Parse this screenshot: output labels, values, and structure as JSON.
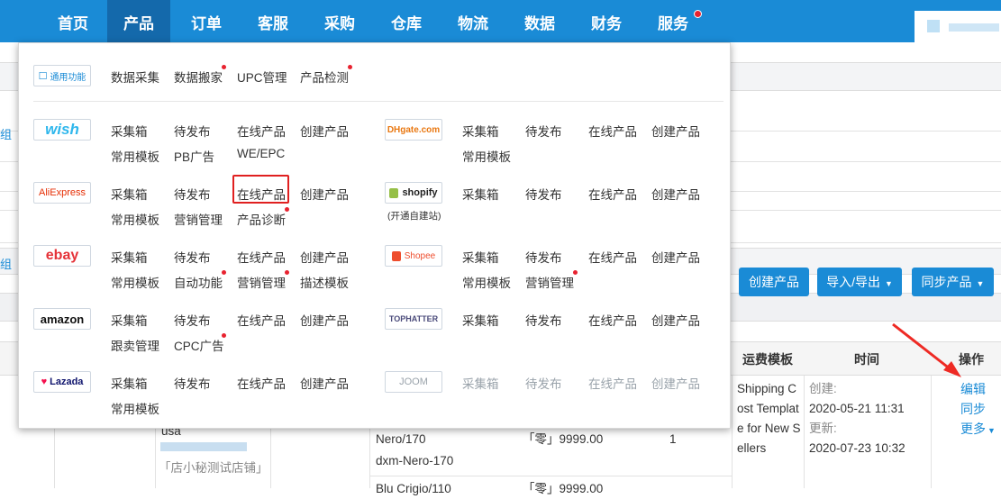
{
  "nav": {
    "items": [
      "首页",
      "产品",
      "订单",
      "客服",
      "采购",
      "仓库",
      "物流",
      "数据",
      "财务",
      "服务"
    ],
    "active": "产品"
  },
  "menu": {
    "general": {
      "logo_text": "通用功能",
      "items": [
        "数据采集",
        "数据搬家",
        "UPC管理",
        "产品检测"
      ]
    },
    "platforms": {
      "wish": {
        "logo": "wish",
        "row1": [
          "采集箱",
          "待发布",
          "在线产品",
          "创建产品"
        ],
        "row2": [
          "常用模板",
          "PB广告",
          "WE/EPC"
        ]
      },
      "dhgate": {
        "logo": "DHgate.com",
        "row1": [
          "采集箱",
          "待发布",
          "在线产品",
          "创建产品"
        ],
        "row2": [
          "常用模板"
        ]
      },
      "aliexpress": {
        "logo": "AliExpress",
        "row1": [
          "采集箱",
          "待发布",
          "在线产品",
          "创建产品"
        ],
        "row2": [
          "常用模板",
          "营销管理",
          "产品诊断"
        ]
      },
      "shopify": {
        "logo": "shopify",
        "sub": "(开通自建站)",
        "row1": [
          "采集箱",
          "待发布",
          "在线产品",
          "创建产品"
        ]
      },
      "ebay": {
        "logo": "ebay",
        "row1": [
          "采集箱",
          "待发布",
          "在线产品",
          "创建产品"
        ],
        "row2": [
          "常用模板",
          "自动功能",
          "营销管理",
          "描述模板"
        ]
      },
      "shopee": {
        "logo": "Shopee",
        "row1": [
          "采集箱",
          "待发布",
          "在线产品",
          "创建产品"
        ],
        "row2": [
          "常用模板",
          "营销管理"
        ]
      },
      "amazon": {
        "logo": "amazon",
        "row1": [
          "采集箱",
          "待发布",
          "在线产品",
          "创建产品"
        ],
        "row2": [
          "跟卖管理",
          "CPC广告"
        ]
      },
      "tophatter": {
        "logo": "TOPHATTER",
        "row1": [
          "采集箱",
          "待发布",
          "在线产品",
          "创建产品"
        ]
      },
      "lazada": {
        "logo": "Lazada",
        "row1": [
          "采集箱",
          "待发布",
          "在线产品",
          "创建产品"
        ],
        "row2": [
          "常用模板"
        ]
      },
      "joom": {
        "logo": "JOOM",
        "row1": [
          "采集箱",
          "待发布",
          "在线产品",
          "创建产品"
        ]
      }
    }
  },
  "page": {
    "edge_labels": [
      "组",
      "组"
    ],
    "buttons": {
      "create": "创建产品",
      "import_export": "导入/导出",
      "sync": "同步产品"
    },
    "table_headers": {
      "shipping_template": "运费模板",
      "time": "时间",
      "actions": "操作"
    },
    "row": {
      "shop_fragment": "usa",
      "shop_name": "「店小秘测试店铺」",
      "sku_lines": [
        "Nero/170",
        "dxm-Nero-170"
      ],
      "next_sku": "Blu Crigio/110",
      "price": "「零」9999.00",
      "next_price": "「零」9999.00",
      "qty": "1",
      "shipping_template_lines": [
        "Shipping C",
        "ost Templat",
        "e for New S",
        "ellers"
      ],
      "created_label": "创建:",
      "created_value": "2020-05-21 11:31",
      "updated_label": "更新:",
      "updated_value": "2020-07-23 10:32",
      "actions": {
        "edit": "编辑",
        "sync": "同步",
        "more": "更多"
      }
    }
  },
  "colors": {
    "nav_bg": "#1a8bd6",
    "nav_active": "#1469ab",
    "highlight": "#e02020",
    "red_dot": "#e8222f",
    "arrow": "#ee2a24"
  }
}
